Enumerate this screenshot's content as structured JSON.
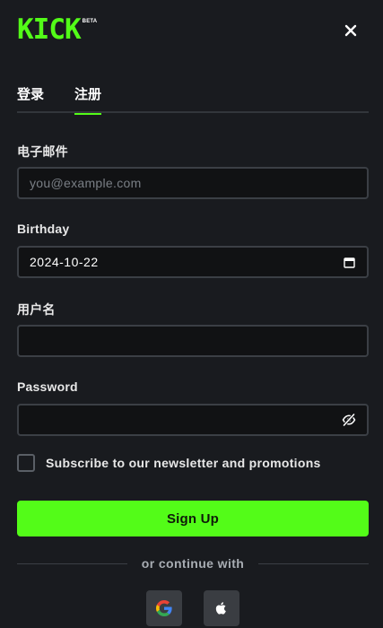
{
  "header": {
    "logo_text": "KICK",
    "logo_badge": "BETA",
    "close_icon": "close-icon"
  },
  "tabs": [
    {
      "label": "登录",
      "active": false
    },
    {
      "label": "注册",
      "active": true
    }
  ],
  "form": {
    "email": {
      "label": "电子邮件",
      "placeholder": "you@example.com",
      "value": ""
    },
    "birthday": {
      "label": "Birthday",
      "value": "2024-10-22",
      "icon": "calendar-icon"
    },
    "username": {
      "label": "用户名",
      "value": ""
    },
    "password": {
      "label": "Password",
      "value": "",
      "icon": "eye-off-icon"
    },
    "newsletter": {
      "label": "Subscribe to our newsletter and promotions",
      "checked": false
    },
    "submit_label": "Sign Up"
  },
  "divider_text": "or continue with",
  "social": [
    {
      "name": "google",
      "icon": "google-icon"
    },
    {
      "name": "apple",
      "icon": "apple-icon"
    }
  ],
  "colors": {
    "accent": "#53fc18",
    "background": "#191b1f",
    "input_bg": "#111214",
    "border": "#3b3f45"
  }
}
